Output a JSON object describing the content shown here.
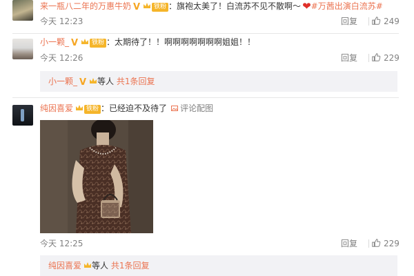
{
  "comments": [
    {
      "username": "来一瓶八二年的万惠牛奶",
      "fan_label": "铁粉",
      "text": "旗袍太美了！白流苏不见不散啊～",
      "topic": "#万茜出演白流苏#",
      "time": "今天 12:23",
      "reply_label": "回复",
      "likes": "249"
    },
    {
      "username": "小一颗_",
      "fan_label": "铁粉",
      "text": "太期待了！！啊啊啊啊啊啊啊姐姐！！",
      "time": "今天 12:26",
      "reply_label": "回复",
      "likes": "229",
      "sub_reply": {
        "username": "小一颗_",
        "middle": "等人",
        "more": "共1条回复"
      }
    },
    {
      "username": "纯因喜爱",
      "fan_label": "铁粉",
      "text": "已经迫不及待了",
      "pic_link": "评论配图",
      "time": "今天 12:25",
      "reply_label": "回复",
      "likes": "229",
      "sub_reply": {
        "username": "纯因喜爱",
        "middle": "等人",
        "more": "共1条回复"
      }
    }
  ],
  "colors": {
    "accent": "#eb7350",
    "badge": "#f5b52a",
    "muted": "#808080",
    "sub_bg": "#f2f2f5"
  },
  "icons": [
    "verified-v-icon",
    "crown-icon",
    "heart-icon",
    "thumbs-up-icon",
    "picture-icon"
  ]
}
